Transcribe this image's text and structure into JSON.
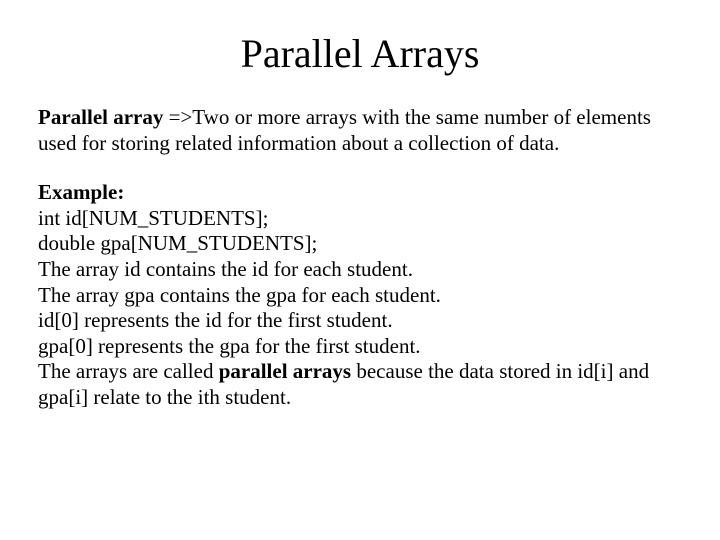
{
  "title": "Parallel Arrays",
  "para1_bold": "Parallel array ",
  "para1_rest": "=>Two or more arrays with the same number of elements used for storing related information about a collection of data.",
  "example_label": "Example:",
  "line1": "int id[NUM_STUDENTS];",
  "line2": "double gpa[NUM_STUDENTS];",
  "line3": "The array id contains the id for each student.",
  "line4": "The array gpa contains the gpa for each student.",
  "line5": "id[0] represents the id for the first student.",
  "line6": "gpa[0] represents the gpa for the first student.",
  "line7a": "The arrays are called ",
  "line7b": "parallel arrays",
  "line7c": " because the data stored in id[i] and gpa[i] relate to the ith student."
}
